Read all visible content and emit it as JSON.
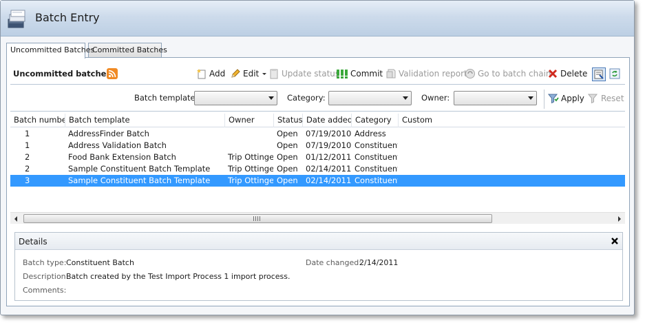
{
  "window": {
    "title": "Batch Entry",
    "app_icon": "batch-entry-icon"
  },
  "tabs": [
    {
      "label": "Uncommitted Batches",
      "active": true
    },
    {
      "label": "Committed Batches",
      "active": false
    }
  ],
  "section": {
    "title": "Uncommitted batches",
    "rss_icon": "rss-feed-icon"
  },
  "toolbar": {
    "add": "Add",
    "edit": "Edit",
    "update_status": "Update status",
    "commit": "Commit",
    "validation_report": "Validation report",
    "go_to_batch_chain": "Go to batch chain",
    "delete": "Delete"
  },
  "filters": {
    "batch_template_label": "Batch template:",
    "batch_template_value": "",
    "category_label": "Category:",
    "category_value": "",
    "owner_label": "Owner:",
    "owner_value": "",
    "apply": "Apply",
    "reset": "Reset"
  },
  "grid": {
    "columns": [
      "Batch number",
      "Batch template",
      "Owner",
      "Status",
      "Date added",
      "Category",
      "Custom"
    ],
    "rows": [
      {
        "batch_number": "1",
        "batch_template": "AddressFinder Batch",
        "owner": "",
        "status": "Open",
        "date_added": "07/19/2010",
        "category": "Address",
        "custom": "",
        "selected": false
      },
      {
        "batch_number": "1",
        "batch_template": "Address Validation Batch",
        "owner": "",
        "status": "Open",
        "date_added": "07/19/2010",
        "category": "Constituent",
        "custom": "",
        "selected": false
      },
      {
        "batch_number": "2",
        "batch_template": "Food Bank Extension Batch",
        "owner": "Trip Ottinger",
        "status": "Open",
        "date_added": "01/12/2011",
        "category": "Constituent",
        "custom": "",
        "selected": false
      },
      {
        "batch_number": "2",
        "batch_template": "Sample Constituent Batch Template",
        "owner": "Trip Ottinger",
        "status": "Open",
        "date_added": "02/14/2011",
        "category": "Constituent",
        "custom": "",
        "selected": false
      },
      {
        "batch_number": "3",
        "batch_template": "Sample Constituent Batch Template",
        "owner": "Trip Ottinger",
        "status": "Open",
        "date_added": "02/14/2011",
        "category": "Constituent",
        "custom": "",
        "selected": true
      }
    ],
    "scrollbar_grip": "III"
  },
  "details": {
    "title": "Details",
    "batch_type_label": "Batch type:",
    "batch_type_value": "Constituent Batch",
    "date_changed_label": "Date changed:",
    "date_changed_value": "2/14/2011",
    "description_label": "Description:",
    "description_value": "Batch created by the Test Import Process 1 import process.",
    "comments_label": "Comments:",
    "comments_value": ""
  },
  "colors": {
    "selection": "#3399ff",
    "header_gradient_top": "#e6eef7",
    "header_gradient_bottom": "#bccfe4",
    "disabled_text": "#9a9a9a"
  }
}
